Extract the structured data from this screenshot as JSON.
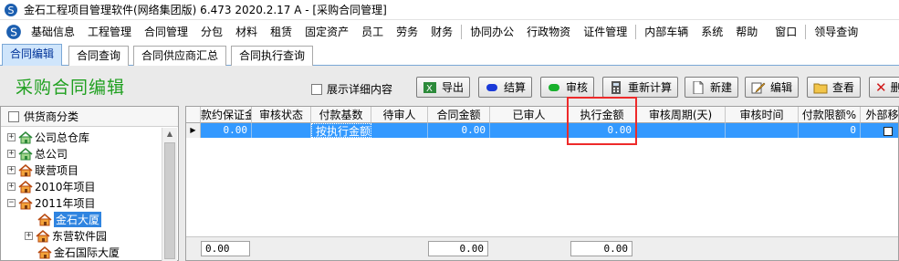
{
  "window": {
    "title": "金石工程项目管理软件(网络集团版) 6.473  2020.2.17 A - [采购合同管理]"
  },
  "menu": {
    "items": [
      "基础信息",
      "工程管理",
      "合同管理",
      "分包",
      "材料",
      "租赁",
      "固定资产",
      "员工",
      "劳务",
      "财务",
      "协同办公",
      "行政物资",
      "证件管理",
      "内部车辆",
      "系统",
      "帮助",
      "窗口",
      "领导查询"
    ]
  },
  "tabs": [
    "合同编辑",
    "合同查询",
    "合同供应商汇总",
    "合同执行查询"
  ],
  "page": {
    "title": "采购合同编辑",
    "show_detail": "展示详细内容"
  },
  "toolbar": {
    "export": "导出",
    "settle": "结算",
    "audit": "审核",
    "recalc": "重新计算",
    "new": "新建",
    "edit": "编辑",
    "view": "查看",
    "delete": "删"
  },
  "tree": {
    "header": "供货商分类",
    "items": [
      "公司总仓库",
      "总公司",
      "联营项目",
      "2010年项目",
      "2011年项目",
      "金石大厦",
      "东营软件园",
      "金石国际大厦"
    ]
  },
  "grid": {
    "columns": [
      "款约保证金",
      "审核状态",
      "付款基数",
      "待审人",
      "合同金额",
      "已审人",
      "执行金额",
      "审核周期(天)",
      "审核时间",
      "付款限额%",
      "外部移交"
    ],
    "row": {
      "deposit": "0.00",
      "status": "",
      "pay_base": "按执行金额",
      "pending": "",
      "amount": "0.00",
      "approved": "",
      "exec_amount": "0.00",
      "cycle": "",
      "time": "",
      "limit": "0",
      "external": ""
    },
    "footer": {
      "deposit_total": "0.00",
      "amount_total": "0.00",
      "exec_total": "0.00"
    }
  },
  "colors": {
    "accent": "#3399ff",
    "title_green": "#20a020",
    "highlight": "#ee2a2a"
  }
}
